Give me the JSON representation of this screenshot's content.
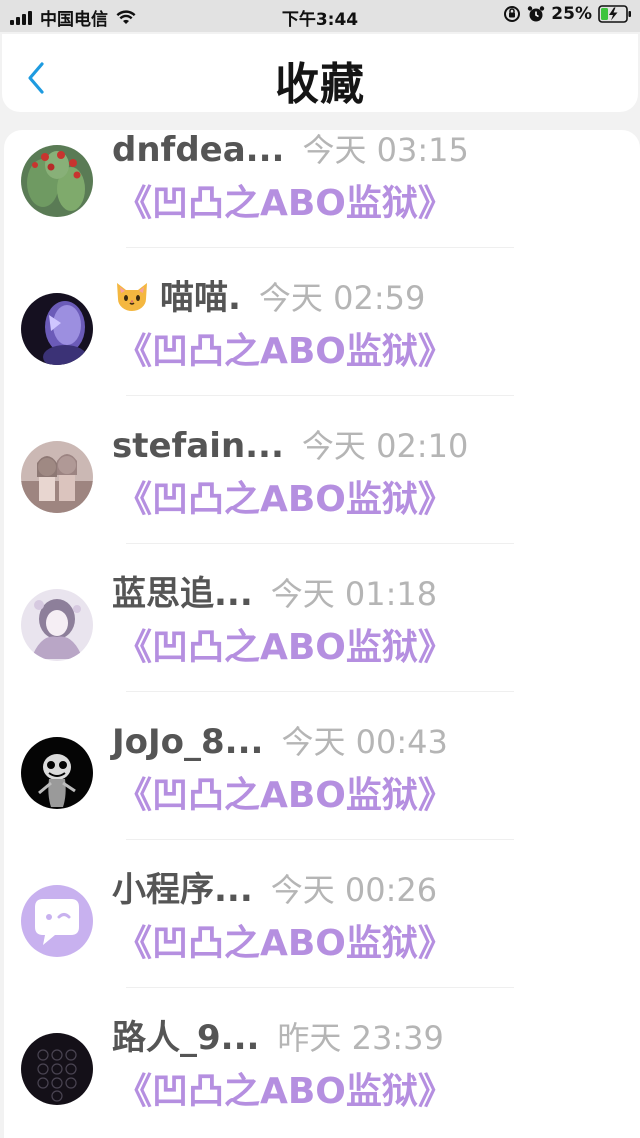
{
  "status_bar": {
    "carrier": "中国电信",
    "time": "下午3:44",
    "battery": "25%"
  },
  "header": {
    "title": "收藏"
  },
  "colors": {
    "accent": "#1e9be0",
    "book_title": "#b58fe0"
  },
  "items": [
    {
      "name": "dnfdea...",
      "time": "今天 03:15",
      "book": "《凹凸之ABO监狱》",
      "avatar": "cactus-avatar"
    },
    {
      "name": "喵喵.",
      "time": "今天 02:59",
      "book": "《凹凸之ABO监狱》",
      "avatar": "purple-portrait-avatar",
      "emoji": "cat-face-icon"
    },
    {
      "name": "stefain...",
      "time": "今天 02:10",
      "book": "《凹凸之ABO监狱》",
      "avatar": "two-girls-avatar"
    },
    {
      "name": "蓝思追...",
      "time": "今天 01:18",
      "book": "《凹凸之ABO监狱》",
      "avatar": "anime-girl-avatar"
    },
    {
      "name": "JoJo_8...",
      "time": "今天 00:43",
      "book": "《凹凸之ABO监狱》",
      "avatar": "dark-creature-avatar"
    },
    {
      "name": "小程序...",
      "time": "今天 00:26",
      "book": "《凹凸之ABO监狱》",
      "avatar": "chat-bubble-avatar"
    },
    {
      "name": "路人_9...",
      "time": "昨天 23:39",
      "book": "《凹凸之ABO监狱》",
      "avatar": "keypad-avatar"
    }
  ]
}
